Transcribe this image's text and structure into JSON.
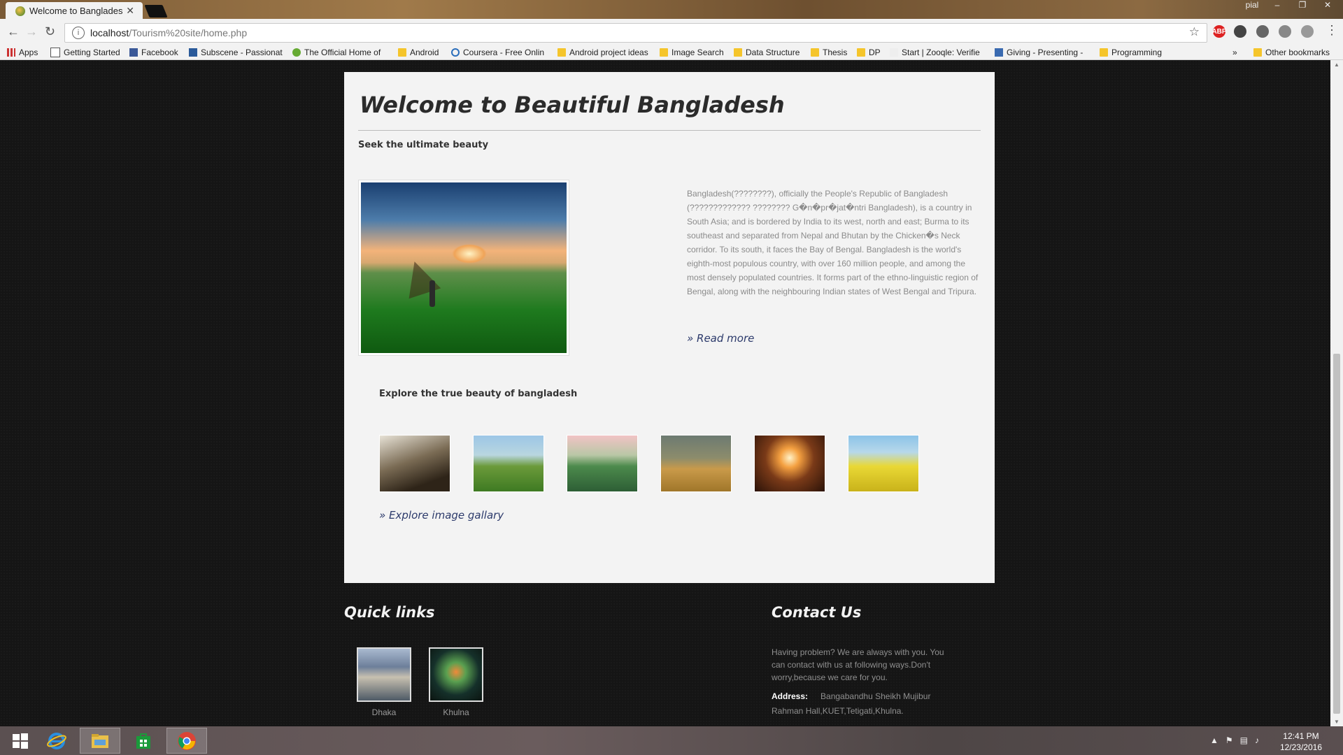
{
  "browser": {
    "tab_title": "Welcome to Bangladesh",
    "tab_close": "✕",
    "url_host": "localhost",
    "url_path": "/Tourism%20site/home.php",
    "user_name": "pial",
    "bookmarks": [
      {
        "label": "Apps",
        "icon": "apps-grid-icon"
      },
      {
        "label": "Getting Started",
        "icon": "page-icon"
      },
      {
        "label": "Facebook",
        "icon": "facebook-icon"
      },
      {
        "label": "Subscene - Passionat",
        "icon": "subscene-icon"
      },
      {
        "label": "The Official Home of",
        "icon": "site-icon"
      },
      {
        "label": "Android",
        "icon": "folder-icon"
      },
      {
        "label": "Coursera - Free Onlin",
        "icon": "coursera-icon"
      },
      {
        "label": "Android project ideas",
        "icon": "folder-icon"
      },
      {
        "label": "Image Search",
        "icon": "folder-icon"
      },
      {
        "label": "Data Structure",
        "icon": "folder-icon"
      },
      {
        "label": "Thesis",
        "icon": "folder-icon"
      },
      {
        "label": "DP",
        "icon": "folder-icon"
      },
      {
        "label": "Start | Zooqle: Verifie",
        "icon": "site-icon"
      },
      {
        "label": "Giving - Presenting -",
        "icon": "site-icon"
      },
      {
        "label": "Programming",
        "icon": "folder-icon"
      }
    ],
    "bookmarks_overflow": "»",
    "other_bookmarks": "Other bookmarks"
  },
  "main": {
    "title": "Welcome to Beautiful Bangladesh",
    "subtitle": "Seek the ultimate beauty",
    "description": "Bangladesh(????????), officially the People's Republic of Bangladesh (????????????? ???????? G�n�pr�jat�ntri Bangladesh), is a country in South Asia; and is bordered by India to its west, north and east; Burma to its southeast and separated from Nepal and Bhutan by the Chicken�s Neck corridor. To its south, it faces the Bay of Bengal. Bangladesh is the world's eighth-most populous country, with over 160 million people, and among the most densely populated countries. It forms part of the ethno-linguistic region of Bengal, along with the neighbouring Indian states of West Bengal and Tripura.",
    "read_more": "» Read more",
    "explore_title": "Explore the true beauty of bangladesh",
    "gallery_link": "» Explore image gallary"
  },
  "footer": {
    "quick_links_title": "Quick links",
    "quick_links": [
      {
        "label": "Dhaka"
      },
      {
        "label": "Khulna"
      }
    ],
    "contact_title": "Contact Us",
    "contact_text": "Having problem? We are always with you. You can contact with us at following ways.Don't worry,because we care for you.",
    "address_label": "Address:",
    "address_value": "Bangabandhu Sheikh Mujibur Rahman Hall,KUET,Tetigati,Khulna."
  },
  "taskbar": {
    "time": "12:41 PM",
    "date": "12/23/2016",
    "apps": [
      "windows-start-icon",
      "internet-explorer-icon",
      "file-explorer-icon",
      "store-icon",
      "chrome-icon"
    ]
  },
  "colors": {
    "link": "#2c3a6b",
    "page_bg": "#151515",
    "content_bg": "#f3f3f3"
  }
}
